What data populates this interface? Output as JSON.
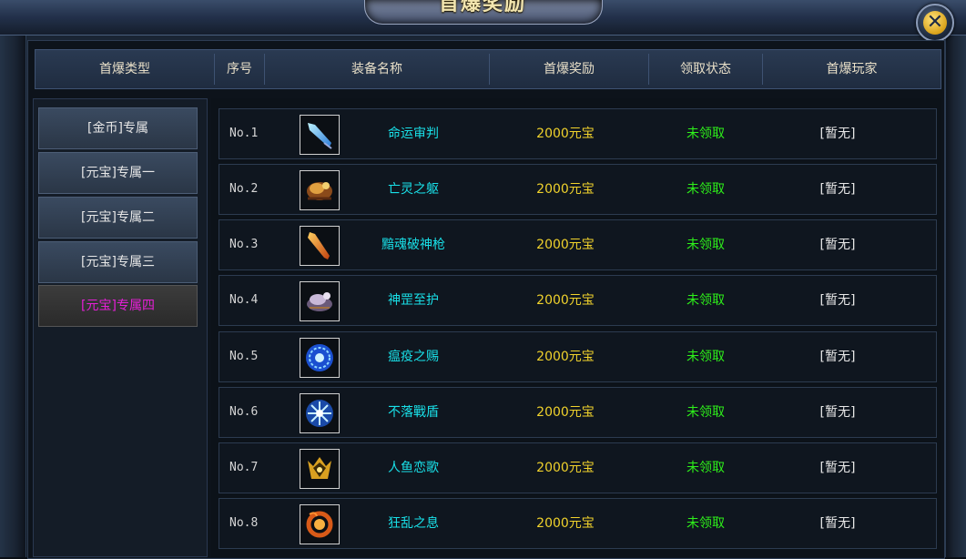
{
  "window": {
    "title": "首爆奖励",
    "close_label": "✕"
  },
  "header": {
    "columns": [
      "首爆类型",
      "序号",
      "装备名称",
      "首爆奖励",
      "领取状态",
      "首爆玩家"
    ]
  },
  "sidebar": {
    "items": [
      {
        "label": "[金币]专属",
        "active": false
      },
      {
        "label": "[元宝]专属一",
        "active": false
      },
      {
        "label": "[元宝]专属二",
        "active": false
      },
      {
        "label": "[元宝]专属三",
        "active": false
      },
      {
        "label": "[元宝]专属四",
        "active": true
      }
    ]
  },
  "rows": [
    {
      "no": "No.1",
      "icon": "ice-blade-icon",
      "name": "命运审判",
      "reward": "2000元宝",
      "status": "未领取",
      "player": "[暂无]"
    },
    {
      "no": "No.2",
      "icon": "beast-mount-icon",
      "name": "亡灵之躯",
      "reward": "2000元宝",
      "status": "未领取",
      "player": "[暂无]"
    },
    {
      "no": "No.3",
      "icon": "fire-spear-icon",
      "name": "黯魂破神枪",
      "reward": "2000元宝",
      "status": "未领取",
      "player": "[暂无]"
    },
    {
      "no": "No.4",
      "icon": "armored-pet-icon",
      "name": "神罡至护",
      "reward": "2000元宝",
      "status": "未领取",
      "player": "[暂无]"
    },
    {
      "no": "No.5",
      "icon": "blue-orb-icon",
      "name": "瘟疫之赐",
      "reward": "2000元宝",
      "status": "未领取",
      "player": "[暂无]"
    },
    {
      "no": "No.6",
      "icon": "frost-shield-icon",
      "name": "不落戰盾",
      "reward": "2000元宝",
      "status": "未领取",
      "player": "[暂无]"
    },
    {
      "no": "No.7",
      "icon": "golden-crest-icon",
      "name": "人鱼恋歌",
      "reward": "2000元宝",
      "status": "未领取",
      "player": "[暂无]"
    },
    {
      "no": "No.8",
      "icon": "flame-ring-icon",
      "name": "狂乱之息",
      "reward": "2000元宝",
      "status": "未领取",
      "player": "[暂无]"
    }
  ],
  "colors": {
    "name": "#19e0e8",
    "reward": "#f0d22c",
    "status": "#2ef01a",
    "active_category": "#e51fd6"
  }
}
